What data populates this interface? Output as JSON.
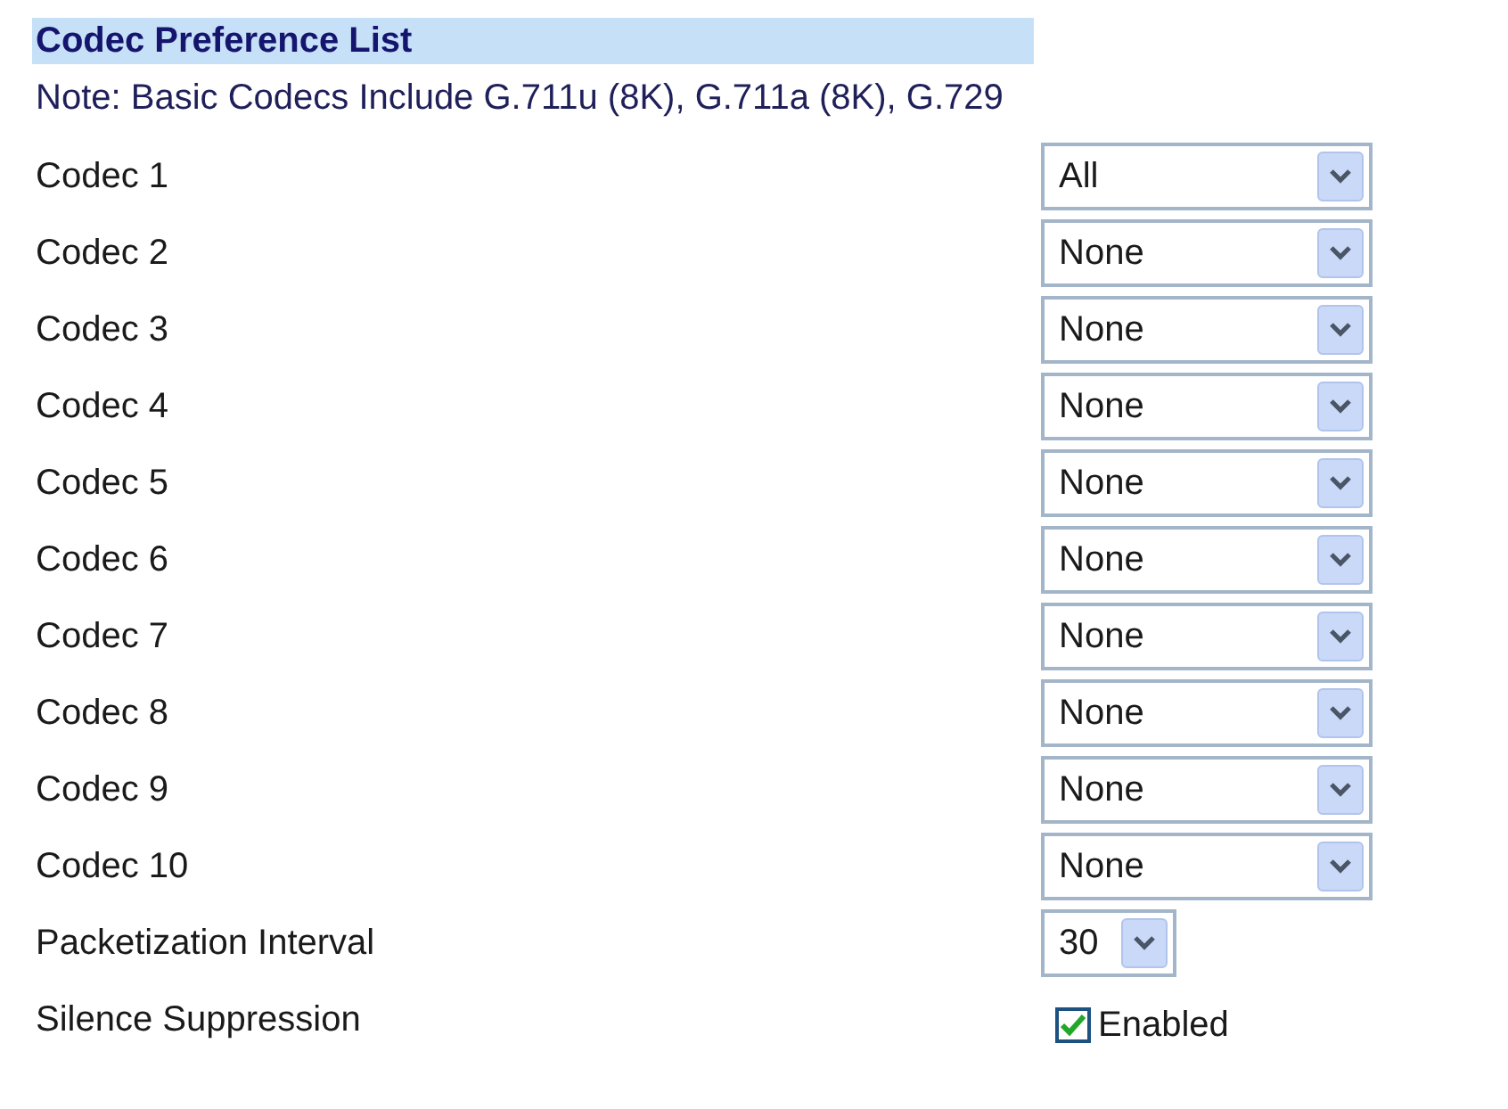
{
  "section": {
    "title": "Codec Preference List",
    "note": "Note: Basic Codecs Include G.711u (8K), G.711a (8K), G.729"
  },
  "settings": [
    {
      "kind": "select",
      "label": "Codec 1",
      "value": "All"
    },
    {
      "kind": "select",
      "label": "Codec 2",
      "value": "None"
    },
    {
      "kind": "select",
      "label": "Codec 3",
      "value": "None"
    },
    {
      "kind": "select",
      "label": "Codec 4",
      "value": "None"
    },
    {
      "kind": "select",
      "label": "Codec 5",
      "value": "None"
    },
    {
      "kind": "select",
      "label": "Codec 6",
      "value": "None"
    },
    {
      "kind": "select",
      "label": "Codec 7",
      "value": "None"
    },
    {
      "kind": "select",
      "label": "Codec 8",
      "value": "None"
    },
    {
      "kind": "select",
      "label": "Codec 9",
      "value": "None"
    },
    {
      "kind": "select",
      "label": "Codec 10",
      "value": "None"
    },
    {
      "kind": "small-select",
      "label": "Packetization Interval",
      "value": "30"
    },
    {
      "kind": "checkbox",
      "label": "Silence Suppression",
      "option": "Enabled",
      "checked": true
    }
  ]
}
